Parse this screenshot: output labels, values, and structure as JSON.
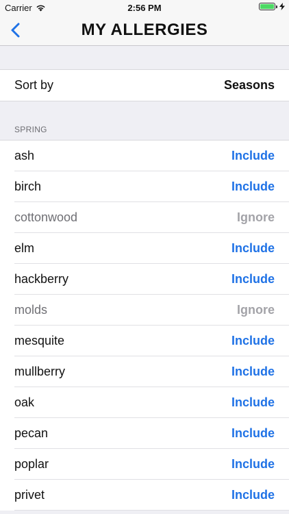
{
  "status_bar": {
    "carrier": "Carrier",
    "time": "2:56 PM",
    "battery_level": 1.0
  },
  "nav": {
    "title": "MY ALLERGIES",
    "back_icon": "chevron-left-icon"
  },
  "sort": {
    "label": "Sort by",
    "value": "Seasons"
  },
  "section": {
    "header": "SPRING"
  },
  "items": [
    {
      "name": "ash",
      "status": "Include"
    },
    {
      "name": "birch",
      "status": "Include"
    },
    {
      "name": "cottonwood",
      "status": "Ignore"
    },
    {
      "name": "elm",
      "status": "Include"
    },
    {
      "name": "hackberry",
      "status": "Include"
    },
    {
      "name": "molds",
      "status": "Ignore"
    },
    {
      "name": "mesquite",
      "status": "Include"
    },
    {
      "name": "mullberry",
      "status": "Include"
    },
    {
      "name": "oak",
      "status": "Include"
    },
    {
      "name": "pecan",
      "status": "Include"
    },
    {
      "name": "poplar",
      "status": "Include"
    },
    {
      "name": "privet",
      "status": "Include"
    }
  ],
  "colors": {
    "include": "#1f72e6",
    "ignore": "#a3a3a8",
    "battery": "#4cd964"
  }
}
